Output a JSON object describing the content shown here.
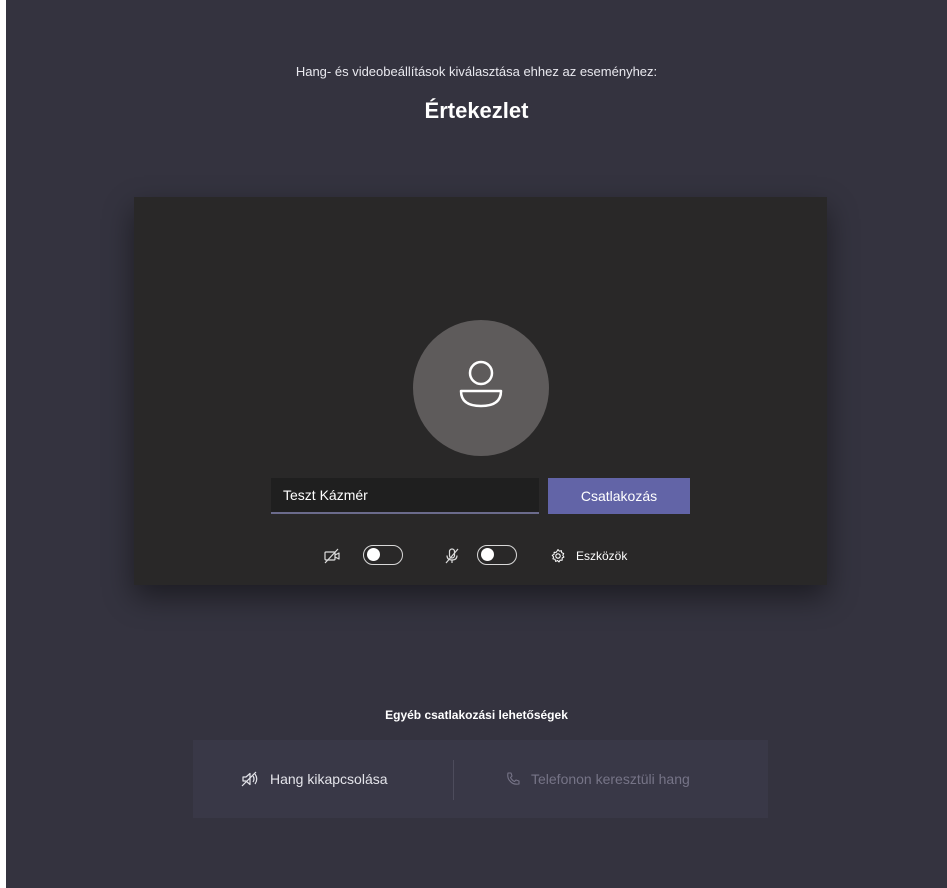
{
  "header": {
    "subtitle": "Hang- és videobeállítások kiválasztása ehhez az eseményhez:",
    "title": "Értekezlet"
  },
  "prejoin": {
    "avatar_icon": "person-icon",
    "name_value": "Teszt Kázmér",
    "join_label": "Csatlakozás",
    "camera": {
      "icon": "camera-off-icon",
      "enabled": false
    },
    "microphone": {
      "icon": "mic-off-icon",
      "enabled": false
    },
    "devices_label": "Eszközök",
    "devices_icon": "gear-icon"
  },
  "other_options": {
    "title": "Egyéb csatlakozási lehetőségek",
    "audio_off_label": "Hang kikapcsolása",
    "audio_off_icon": "speaker-off-icon",
    "phone_audio_label": "Telefonon keresztüli hang",
    "phone_audio_icon": "phone-icon"
  },
  "colors": {
    "background": "#34333f",
    "preview": "#292828",
    "accent": "#6264a7",
    "avatar": "#5e5b5b",
    "options_panel": "#393847",
    "disabled_text": "#767487"
  }
}
